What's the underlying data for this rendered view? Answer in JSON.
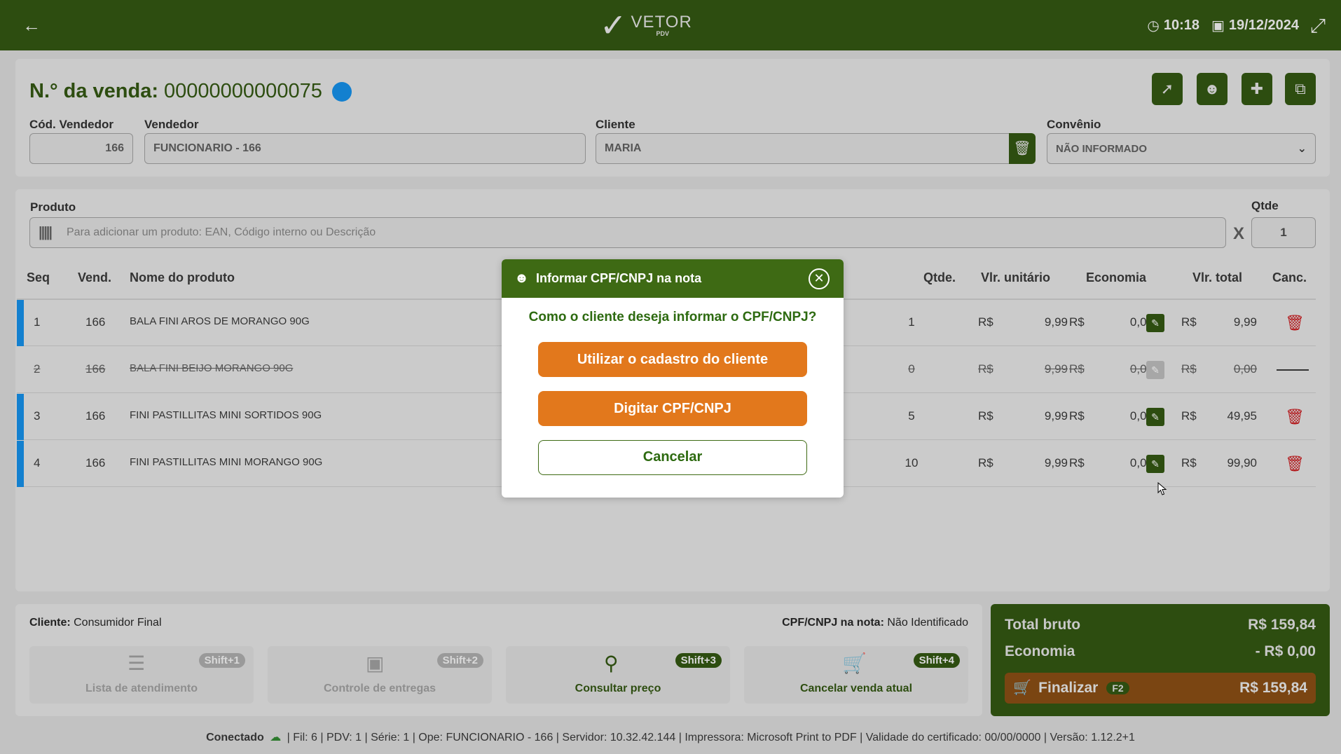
{
  "header": {
    "logo_name": "VETOR",
    "logo_sub": "PDV",
    "time": "10:18",
    "date": "19/12/2024",
    "icons": [
      "back-arrow-icon",
      "clock-icon",
      "calendar-icon",
      "collapse-icon"
    ]
  },
  "sale": {
    "title_label": "N.° da venda:",
    "number": "00000000000075",
    "status_color": "#1380cf",
    "actions": [
      "share-icon",
      "client-id-icon",
      "add-user-icon",
      "copy-icon"
    ],
    "seller_code_label": "Cód. Vendedor",
    "seller_code": "166",
    "seller_label": "Vendedor",
    "seller": "FUNCIONARIO - 166",
    "client_label": "Cliente",
    "client": "MARIA",
    "agreement_label": "Convênio",
    "agreement": "NÃO INFORMADO"
  },
  "product_entry": {
    "label": "Produto",
    "placeholder": "Para adicionar um produto: EAN, Código interno ou Descrição",
    "times": "X",
    "qty_label": "Qtde",
    "qty": "1"
  },
  "table": {
    "columns": {
      "seq": "Seq",
      "seller": "Vend.",
      "name": "Nome do produto",
      "qty": "Qtde.",
      "unit": "Vlr. unitário",
      "discount": "Economia",
      "total": "Vlr. total",
      "cancel": "Canc."
    },
    "currency": "R$",
    "rows": [
      {
        "seq": "1",
        "seller": "166",
        "name": "BALA FINI AROS DE MORANGO 90G",
        "qty": "1",
        "unit": "9,99",
        "discount": "0,00",
        "total": "9,99",
        "cancelled": false
      },
      {
        "seq": "2",
        "seller": "166",
        "name": "BALA FINI BEIJO MORANGO 90G",
        "qty": "0",
        "unit": "9,99",
        "discount": "0,00",
        "total": "0,00",
        "cancelled": true
      },
      {
        "seq": "3",
        "seller": "166",
        "name": "FINI PASTILLITAS MINI SORTIDOS 90G",
        "qty": "5",
        "unit": "9,99",
        "discount": "0,00",
        "total": "49,95",
        "cancelled": false
      },
      {
        "seq": "4",
        "seller": "166",
        "name": "FINI PASTILLITAS MINI MORANGO 90G",
        "qty": "10",
        "unit": "9,99",
        "discount": "0,00",
        "total": "99,90",
        "cancelled": false
      }
    ]
  },
  "footer": {
    "client_label": "Cliente:",
    "client_value": "Consumidor Final",
    "cpf_label": "CPF/CNPJ na nota:",
    "cpf_value": "Não Identificado",
    "shortcuts": [
      {
        "label": "Lista de atendimento",
        "key": "Shift+1",
        "icon": "list-icon"
      },
      {
        "label": "Controle de entregas",
        "key": "Shift+2",
        "icon": "delivery-box-icon"
      },
      {
        "label": "Consultar preço",
        "key": "Shift+3",
        "icon": "price-search-icon"
      },
      {
        "label": "Cancelar venda atual",
        "key": "Shift+4",
        "icon": "cart-cancel-icon"
      }
    ]
  },
  "totals": {
    "gross_label": "Total bruto",
    "gross": "R$ 159,84",
    "discount_label": "Economia",
    "discount": "- R$ 0,00",
    "finish_label": "Finalizar",
    "finish_key": "F2",
    "finish_amount": "R$ 159,84"
  },
  "status_bar": {
    "connected": "Conectado",
    "details": "| Fil: 6 | PDV: 1 | Série: 1 | Ope: FUNCIONARIO - 166 | Servidor: 10.32.42.144 | Impressora: Microsoft Print to PDF | Validade do certificado: 00/00/0000 | Versão: 1.12.2+1"
  },
  "modal": {
    "title": "Informar CPF/CNPJ na nota",
    "question": "Como o cliente deseja informar o CPF/CNPJ?",
    "use_client": "Utilizar o cadastro do cliente",
    "type_cpf": "Digitar CPF/CNPJ",
    "cancel": "Cancelar"
  }
}
